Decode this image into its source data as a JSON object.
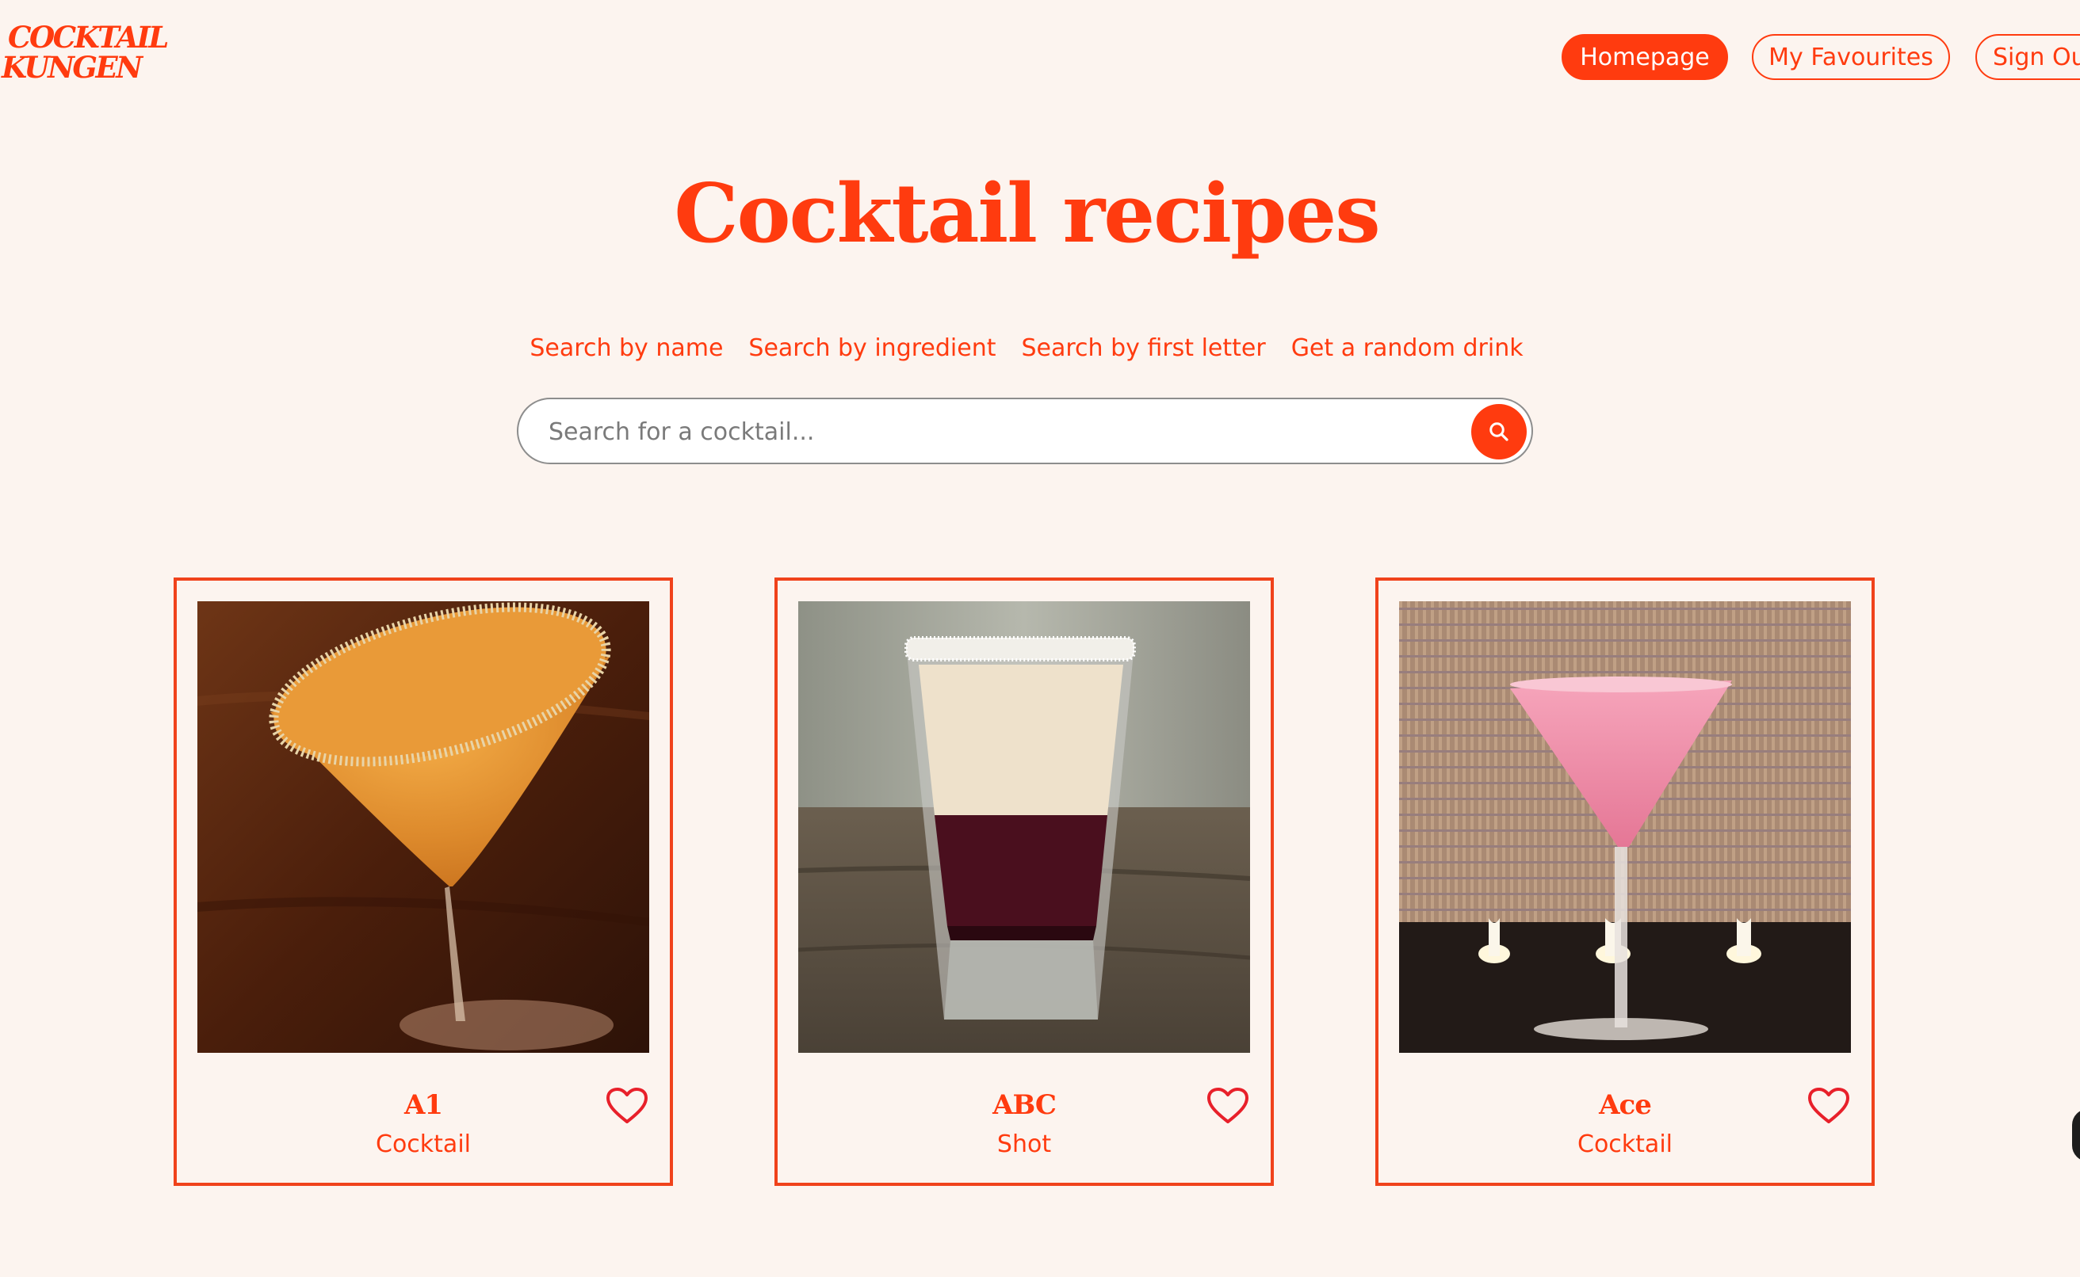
{
  "brand": {
    "line1": "COCKTAIL",
    "line2": "KUNGEN"
  },
  "nav": {
    "homepage": "Homepage",
    "favourites": "My Favourites",
    "sign_out": "Sign Out"
  },
  "page": {
    "title": "Cocktail recipes"
  },
  "search_modes": {
    "by_name": "Search by name",
    "by_ingredient": "Search by ingredient",
    "by_first_letter": "Search by first letter",
    "random": "Get a random drink"
  },
  "search": {
    "placeholder": "Search for a cocktail..."
  },
  "drinks": [
    {
      "name": "A1",
      "category": "Cocktail"
    },
    {
      "name": "ABC",
      "category": "Shot"
    },
    {
      "name": "Ace",
      "category": "Cocktail"
    }
  ],
  "colors": {
    "accent": "#ff3b0f",
    "background": "#fcf4ef"
  }
}
